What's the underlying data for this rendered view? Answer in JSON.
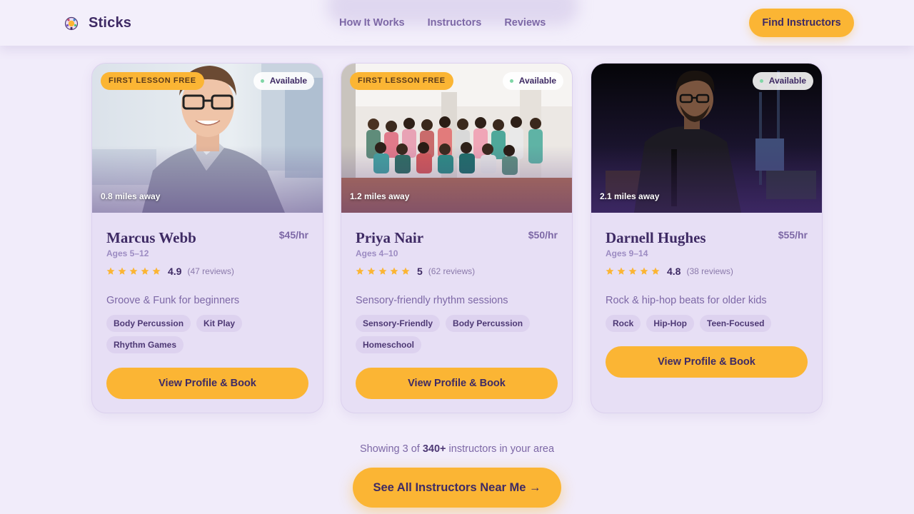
{
  "brand": {
    "name": "Sticks",
    "logo_icon": "drum-logo-icon"
  },
  "nav": {
    "items": [
      "How It Works",
      "Instructors",
      "Reviews"
    ]
  },
  "header": {
    "cta_label": "Find Instructors"
  },
  "colors": {
    "accent": "#fbb534",
    "primary_text": "#3e2a64",
    "muted_text": "#7d68a6",
    "available_dot": "#7fd6a6",
    "star": "#fbb534"
  },
  "instructors": [
    {
      "badge_free": "FIRST LESSON FREE",
      "availability": "Available",
      "distance": "0.8 miles away",
      "name": "Marcus Webb",
      "price": "$45/hr",
      "ages": "Ages 5–12",
      "rating": "4.9",
      "reviews": "(47 reviews)",
      "stars": 5,
      "tagline": "Groove & Funk for beginners",
      "tags": [
        "Body Percussion",
        "Kit Play",
        "Rhythm Games"
      ],
      "button": "View Profile & Book"
    },
    {
      "badge_free": "FIRST LESSON FREE",
      "availability": "Available",
      "distance": "1.2 miles away",
      "name": "Priya Nair",
      "price": "$50/hr",
      "ages": "Ages 4–10",
      "rating": "5",
      "reviews": "(62 reviews)",
      "stars": 5,
      "tagline": "Sensory-friendly rhythm sessions",
      "tags": [
        "Sensory-Friendly",
        "Body Percussion",
        "Homeschool"
      ],
      "button": "View Profile & Book"
    },
    {
      "badge_free": "",
      "availability": "Available",
      "distance": "2.1 miles away",
      "name": "Darnell Hughes",
      "price": "$55/hr",
      "ages": "Ages 9–14",
      "rating": "4.8",
      "reviews": "(38 reviews)",
      "stars": 5,
      "tagline": "Rock & hip-hop beats for older kids",
      "tags": [
        "Rock",
        "Hip-Hop",
        "Teen-Focused"
      ],
      "button": "View Profile & Book"
    }
  ],
  "footer": {
    "showing_prefix": "Showing 3 of",
    "showing_count": "340+",
    "showing_suffix": "instructors in your area",
    "cta_label": "See All Instructors Near Me →"
  }
}
